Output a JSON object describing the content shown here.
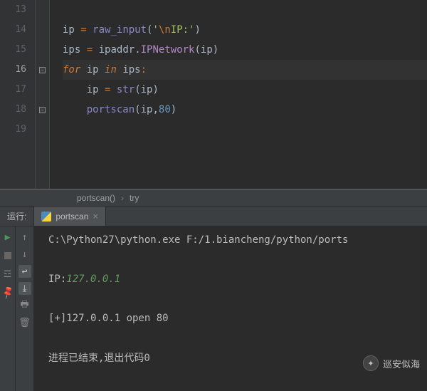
{
  "editor": {
    "lines": [
      13,
      14,
      15,
      16,
      17,
      18,
      19
    ],
    "highlighted": 16,
    "code": {
      "l14": {
        "var": "ip",
        "fn": "raw_input",
        "strPre": "'",
        "esc": "\\n",
        "strPost": "IP:'"
      },
      "l15": {
        "var": "ips",
        "mod": "ipaddr",
        "attr": "IPNetwork",
        "arg": "ip"
      },
      "l16": {
        "kw1": "for",
        "v": "ip",
        "kw2": "in",
        "it": "ips"
      },
      "l17": {
        "var": "ip",
        "fn": "str",
        "arg": "ip"
      },
      "l18": {
        "fn": "portscan",
        "arg": "ip",
        "num": "80"
      }
    }
  },
  "breadcrumb": {
    "a": "portscan()",
    "b": "try"
  },
  "run": {
    "label": "运行:",
    "tab": "portscan"
  },
  "console": {
    "cmd": "C:\\Python27\\python.exe F:/1.biancheng/python/ports",
    "ip_label": "IP:",
    "ip_val": "127.0.0.1",
    "open": "[+]127.0.0.1 open 80",
    "exit": "进程已结束,退出代码0"
  },
  "watermark": "巡安似海"
}
